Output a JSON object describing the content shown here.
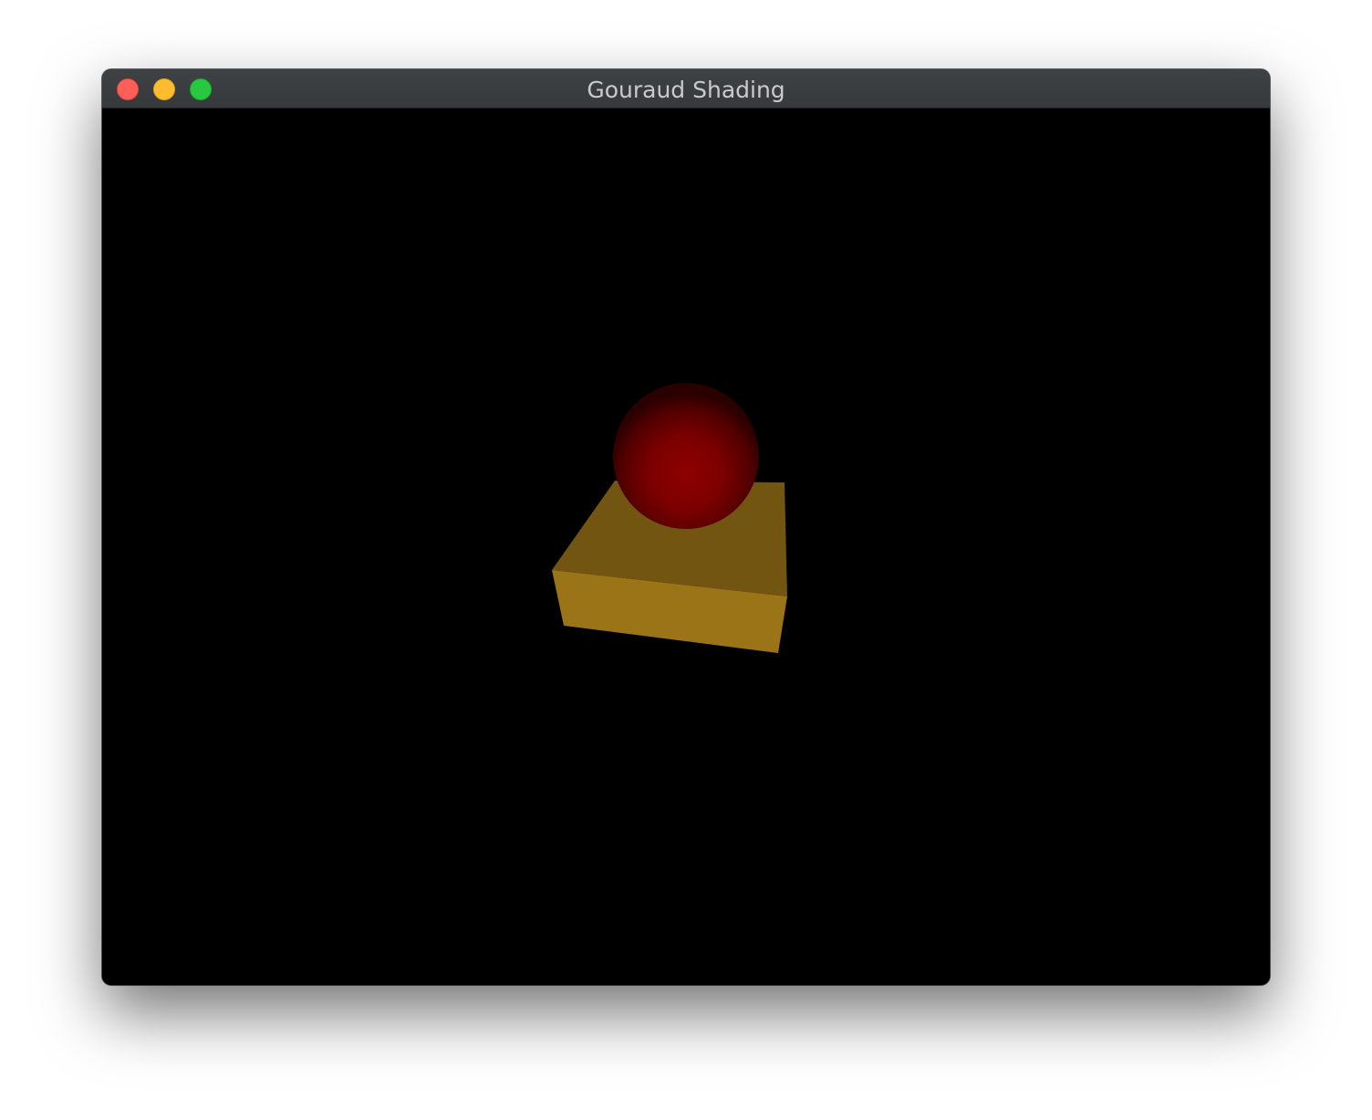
{
  "window": {
    "title": "Gouraud Shading",
    "controls": {
      "close_color": "#fe5f57",
      "minimize_color": "#febc2e",
      "maximize_color": "#28c840"
    }
  },
  "scene": {
    "background_color": "#000000",
    "objects": [
      {
        "name": "sphere",
        "color": "#8a0000"
      },
      {
        "name": "box-top-face",
        "color": "#735512"
      },
      {
        "name": "box-front-face",
        "color": "#9c7418"
      }
    ]
  }
}
